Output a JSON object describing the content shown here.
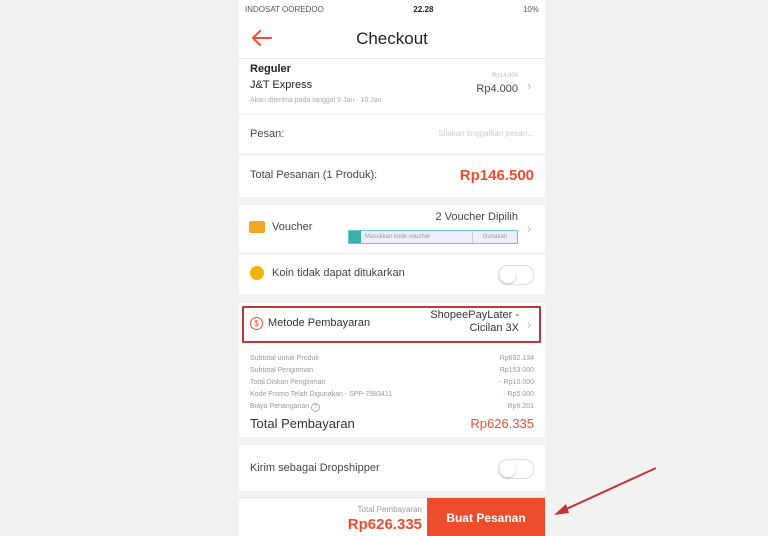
{
  "status_bar": {
    "carrier": "INDOSAT OOREDOO",
    "time": "22.28",
    "battery": "10%"
  },
  "header": {
    "title": "Checkout",
    "back_icon": "back-arrow-icon"
  },
  "shipping": {
    "tier": "Reguler",
    "courier": "J&T Express",
    "eta": "Akan diterima pada tanggal 9 Jan - 10 Jan",
    "price_note": "Rp14.000",
    "price": "Rp4.000"
  },
  "message": {
    "label": "Pesan:",
    "placeholder": "Silakan tinggalkan pesan..."
  },
  "order_total": {
    "label": "Total Pesanan (1 Produk):",
    "value": "Rp146.500"
  },
  "voucher": {
    "label": "Voucher",
    "selected": "2 Voucher Dipilih",
    "input_placeholder": "Masukkan kode voucher",
    "apply_label": "Gunakan"
  },
  "coins": {
    "label": "Koin tidak dapat ditukarkan"
  },
  "payment": {
    "label": "Metode Pembayaran",
    "method_line1": "ShopeePayLater -",
    "method_line2": "Cicilan 3X",
    "highlight_color": "#c0353a"
  },
  "summary": {
    "lines": [
      {
        "label": "Subtotal untuk Produk",
        "value": "Rp692.134"
      },
      {
        "label": "Subtotal Pengiriman",
        "value": "Rp153.000"
      },
      {
        "label": "Total Diskon Pengiriman",
        "value": "- Rp10.000"
      },
      {
        "label": "Kode Promo Telah Digunakan - SPP-7583411",
        "value": "- Rp5.000"
      },
      {
        "label": "Biaya Penanganan",
        "value": "Rp6.201"
      }
    ],
    "total_label": "Total Pembayaran",
    "total_value": "Rp626.335"
  },
  "dropship": {
    "label": "Kirim sebagai Dropshipper"
  },
  "bottom_bar": {
    "total_label": "Total Pembayaran",
    "total_value": "Rp626.335",
    "button_label": "Buat Pesanan"
  },
  "colors": {
    "accent": "#ee4d2d",
    "annotation_arrow": "#c0353a"
  }
}
